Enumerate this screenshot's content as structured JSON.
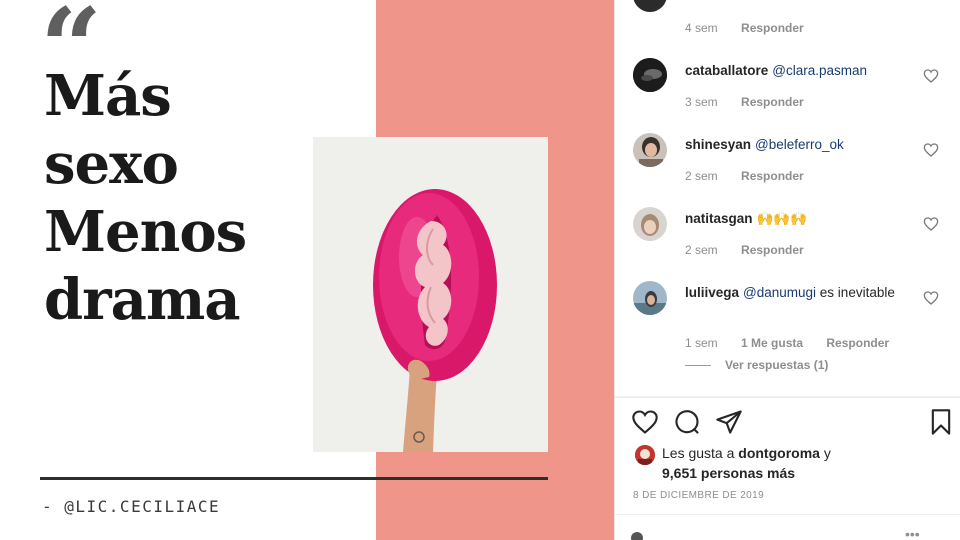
{
  "post": {
    "quote_mark": "“",
    "headline": [
      "Más",
      "sexo",
      "Menos",
      "drama"
    ],
    "handle": "- @LIC.CECILIACE",
    "colors": {
      "accent_band": "#f0958a",
      "pillow": "#e11f72",
      "text": "#1a1a1a"
    }
  },
  "comments": {
    "top_partial": {
      "time": "4 sem",
      "reply": "Responder"
    },
    "items": [
      {
        "user": "cataballatore",
        "mention": "@clara.pasman",
        "text": "",
        "time": "3 sem",
        "likes": "",
        "reply": "Responder",
        "avatar_icon": "avatar-dark"
      },
      {
        "user": "shinesyan",
        "mention": "@beleferro_ok",
        "text": "",
        "time": "2 sem",
        "likes": "",
        "reply": "Responder",
        "avatar_icon": "avatar-photo"
      },
      {
        "user": "natitasgan",
        "mention": "",
        "text": "🙌🙌🙌",
        "time": "2 sem",
        "likes": "",
        "reply": "Responder",
        "avatar_icon": "avatar-photo"
      },
      {
        "user": "luliivega",
        "mention": "@danumugi",
        "text": "es inevitable",
        "time": "1 sem",
        "likes": "1 Me gusta",
        "reply": "Responder",
        "avatar_icon": "avatar-photo"
      }
    ],
    "view_replies": "Ver respuestas (1)"
  },
  "actions": {
    "icons": [
      "heart-icon",
      "comment-icon",
      "share-icon",
      "bookmark-icon"
    ]
  },
  "likes": {
    "prefix": "Les gusta a ",
    "user": "dontgoroma",
    "middle": " y ",
    "count": "9,651 personas más"
  },
  "post_date": "8 DE DICIEMBRE DE 2019"
}
